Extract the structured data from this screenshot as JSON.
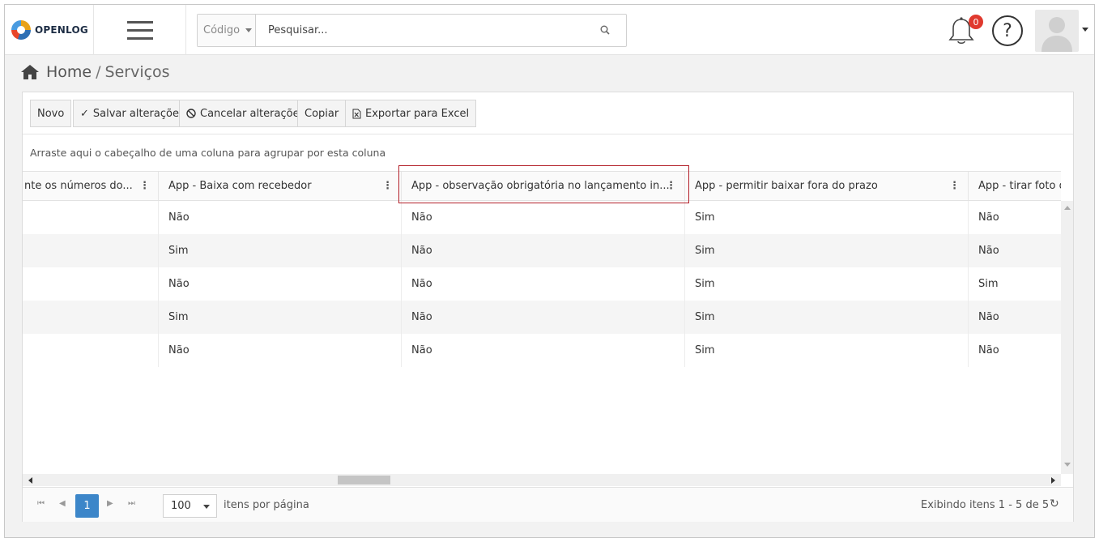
{
  "header": {
    "logo_text": "OPENLOG",
    "search": {
      "type_label": "Código",
      "placeholder": "Pesquisar..."
    },
    "notifications_count": "0",
    "help_label": "?"
  },
  "breadcrumb": {
    "home": "Home",
    "separator": "/",
    "current": "Serviços"
  },
  "toolbar": {
    "new_label": "Novo",
    "save_label": "Salvar alterações",
    "cancel_label": "Cancelar alterações",
    "copy_label": "Copiar",
    "export_label": "Exportar para Excel"
  },
  "grid": {
    "group_hint": "Arraste aqui o cabeçalho de uma coluna para agrupar por esta coluna",
    "columns": [
      "nte os números do...",
      "App - Baixa com recebedor",
      "App - observação obrigatória no lançamento in...",
      "App - permitir baixar fora do prazo",
      "App - tirar foto d"
    ],
    "rows": [
      [
        "",
        "Não",
        "Não",
        "Sim",
        "Não"
      ],
      [
        "",
        "Sim",
        "Não",
        "Sim",
        "Não"
      ],
      [
        "",
        "Não",
        "Não",
        "Sim",
        "Sim"
      ],
      [
        "",
        "Sim",
        "Não",
        "Sim",
        "Não"
      ],
      [
        "",
        "Não",
        "Não",
        "Sim",
        "Não"
      ]
    ]
  },
  "pager": {
    "current_page": "1",
    "page_size": "100",
    "page_size_label": "itens por página",
    "info": "Exibindo itens 1 - 5 de 5"
  }
}
